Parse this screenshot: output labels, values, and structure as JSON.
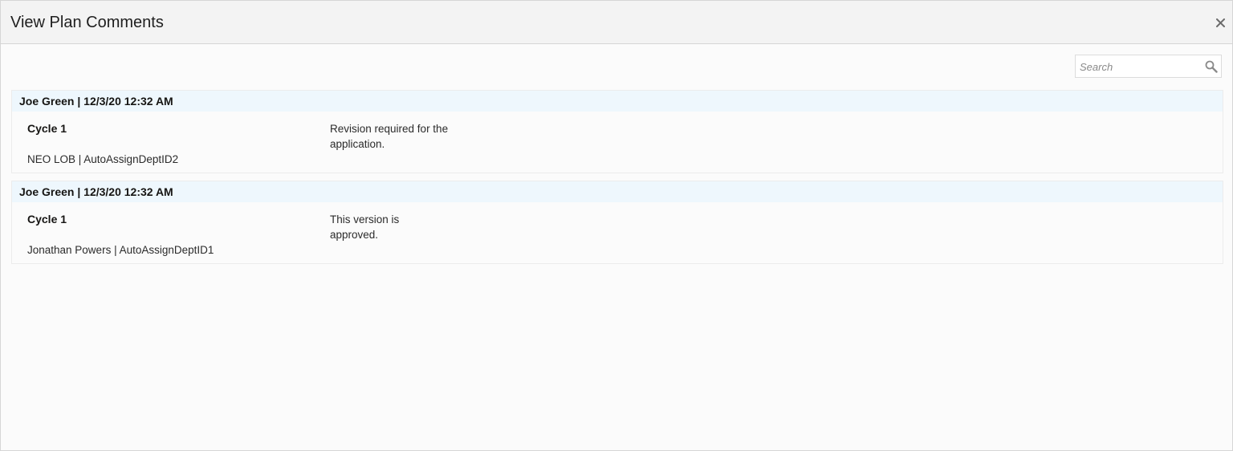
{
  "dialog": {
    "title": "View Plan Comments"
  },
  "search": {
    "placeholder": "Search",
    "value": ""
  },
  "icons": {
    "close": "close-icon",
    "search": "search-icon"
  },
  "colors": {
    "header_bg": "#f3f3f3",
    "comment_header_bg": "#eef7fd",
    "border": "#d6d6d6"
  },
  "comments": [
    {
      "author_line": "Joe Green | 12/3/20 12:32 AM",
      "cycle": "Cycle 1",
      "meta": "NEO LOB | AutoAssignDeptID2",
      "text_line1": "Revision required for the",
      "text_line2": "application."
    },
    {
      "author_line": "Joe Green | 12/3/20 12:32 AM",
      "cycle": "Cycle 1",
      "meta": "Jonathan Powers | AutoAssignDeptID1",
      "text_line1": "This version is",
      "text_line2": "approved."
    }
  ]
}
